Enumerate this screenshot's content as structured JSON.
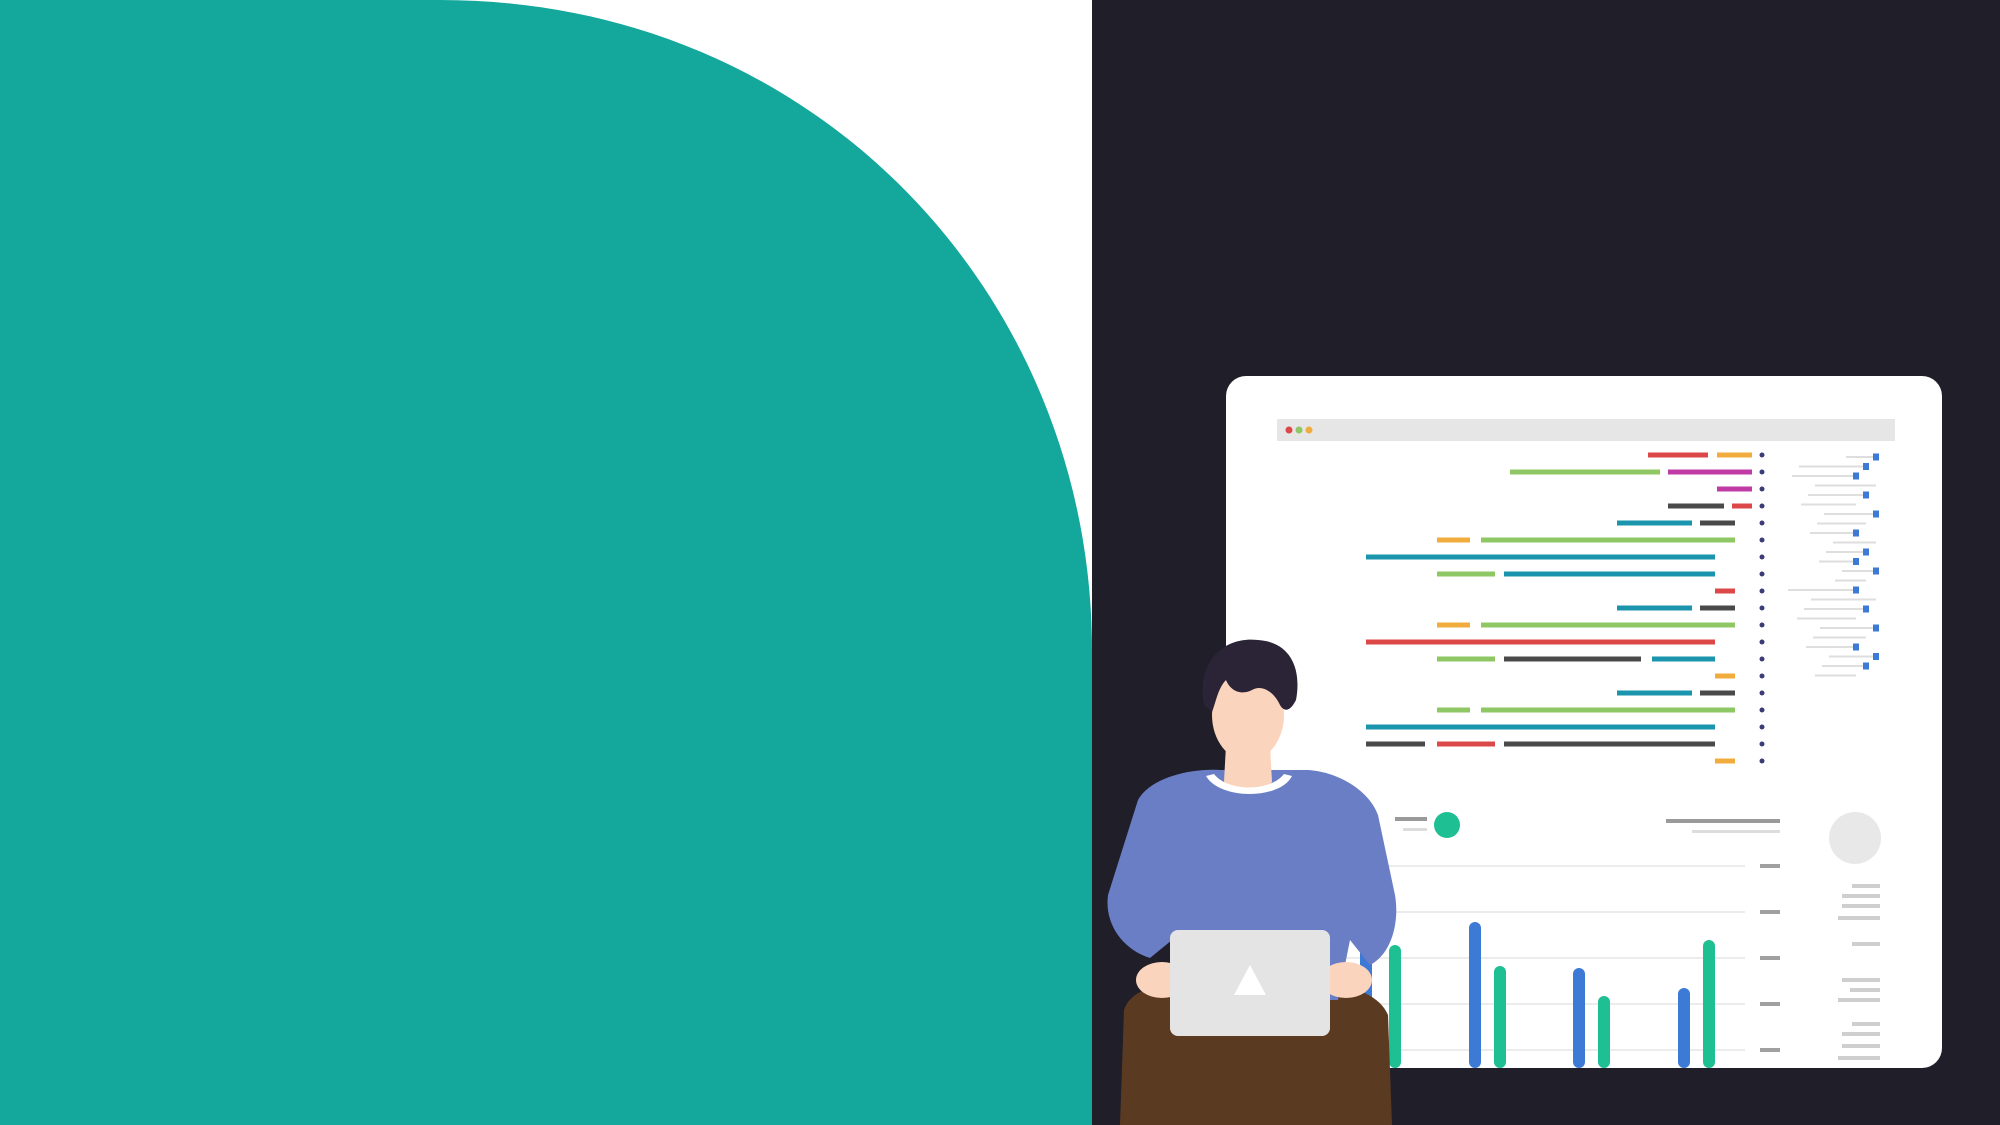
{
  "colors": {
    "teal": "#14a79c",
    "dark_background": "#1f1e29",
    "light_background": "#ffffff",
    "browser_window": "#ffffff",
    "browser_bar": "#e6e6e6",
    "accent_red": "#dc4848",
    "accent_orange": "#f0ad3d",
    "accent_green": "#8fc765",
    "accent_magenta": "#c13ba6",
    "accent_teal_line": "#1b95ad",
    "accent_dark_gray": "#4a4a4a",
    "bar_blue": "#3d7ad6",
    "bar_green": "#1fbf94",
    "shirt_blue": "#6a7ec6",
    "hair": "#2a2436",
    "skin": "#fbd4bd",
    "pants": "#5b3a22",
    "laptop": "#e4e4e4"
  },
  "icons": {
    "window_dots": [
      "red-dot-icon",
      "green-dot-icon",
      "yellow-dot-icon"
    ],
    "laptop_logo": "triangle-logo-icon"
  }
}
